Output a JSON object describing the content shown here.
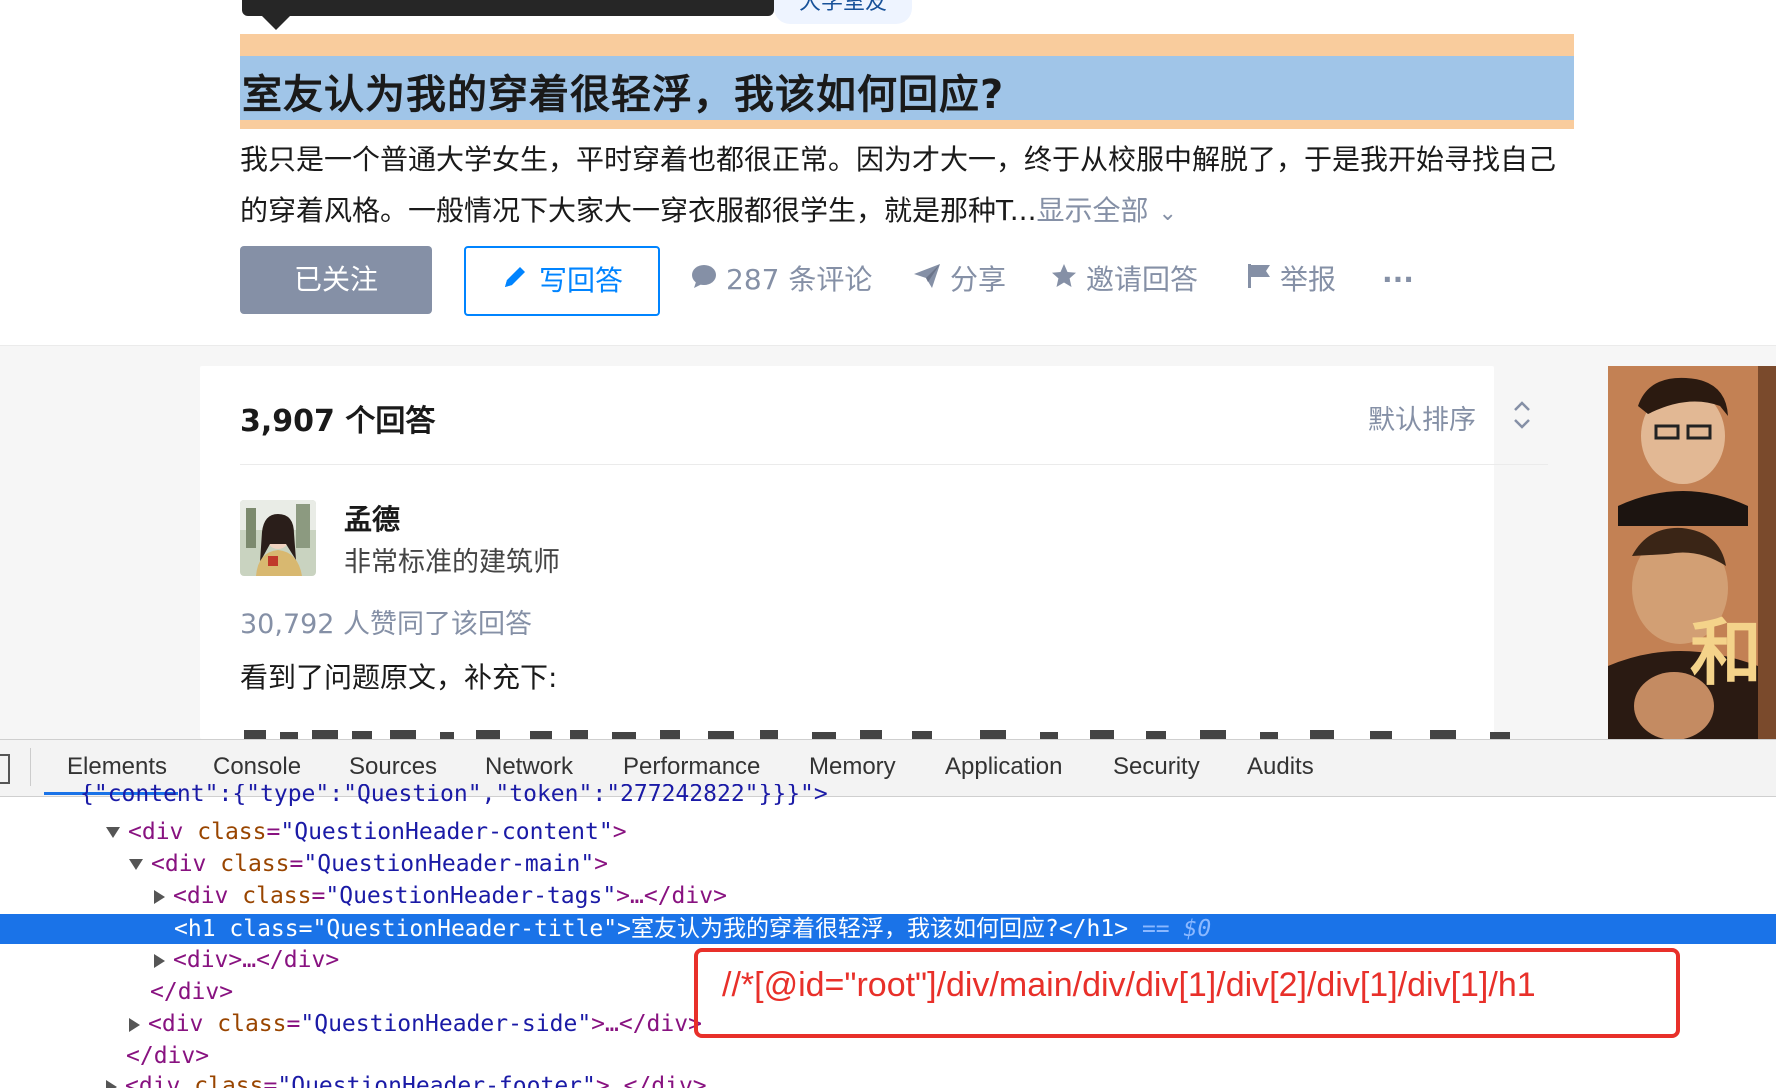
{
  "header": {
    "tag_chip": "大学室友",
    "title": "室友认为我的穿着很轻浮，我该如何回应?",
    "excerpt": "我只是一个普通大学女生，平时穿着也都很正常。因为才大一，终于从校服中解脱了，于是我开始寻找自己的穿着风格。一般情况下大家大一穿衣服都很学生，就是那种T...",
    "show_all": "显示全部",
    "follow_label": "已关注",
    "write_answer_label": "写回答",
    "comments_label": "287 条评论",
    "share_label": "分享",
    "invite_label": "邀请回答",
    "report_label": "举报",
    "more_label": "···"
  },
  "answers": {
    "count_label": "3,907 个回答",
    "sort_label": "默认排序",
    "author_name": "孟德",
    "author_bio": "非常标准的建筑师",
    "votes_label": "30,792 人赞同了该回答",
    "answer_first_line": "看到了问题原文，补充下:"
  },
  "ad": {
    "visible_text": "和"
  },
  "devtools": {
    "tabs": [
      "Elements",
      "Console",
      "Sources",
      "Network",
      "Performance",
      "Memory",
      "Application",
      "Security",
      "Audits"
    ],
    "active_tab": "Elements",
    "lines": {
      "l0": "{\"content\":{\"type\":\"Question\",\"token\":\"277242822\"}}}\">",
      "l1_tag": "div",
      "l1_attr": "class",
      "l1_val": "\"QuestionHeader-content\"",
      "l2_tag": "div",
      "l2_attr": "class",
      "l2_val": "\"QuestionHeader-main\"",
      "l3_tag": "div",
      "l3_attr": "class",
      "l3_val": "\"QuestionHeader-tags\"",
      "l3_tail": ">…</div>",
      "sel_open": "<h1 class=\"QuestionHeader-title\">",
      "sel_text": "室友认为我的穿着很轻浮，我该如何回应?",
      "sel_close": "</h1>",
      "sel_eq": "==",
      "sel_dollar": "$0",
      "l5": "<div>…</div>",
      "l6": "</div>",
      "l7_tag": "div",
      "l7_attr": "class",
      "l7_val": "\"QuestionHeader-side\"",
      "l7_tail": ">…</div>",
      "l8": "</div>",
      "l9_tag": "div",
      "l9_attr": "class",
      "l9_val": "\"QuestionHeader-footer\"",
      "l9_tail": ">…</div>"
    }
  },
  "annotation": {
    "xpath": "//*[@id=\"root\"]/div/main/div/div[1]/div[2]/div[1]/div[1]/h1"
  },
  "colors": {
    "brand_blue": "#0084ff",
    "muted_gray": "#8590a6",
    "devtools_selection": "#1a73e8",
    "annotation_red": "#e8302a",
    "highlight_padding": "#f9cc9d",
    "highlight_content": "#a0c5e8"
  }
}
